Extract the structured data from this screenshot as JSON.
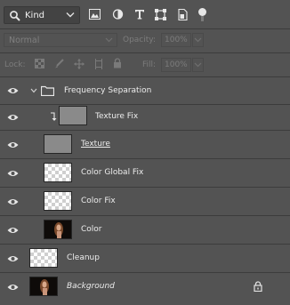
{
  "filter": {
    "kind_label": "Kind"
  },
  "blend": {
    "mode": "Normal"
  },
  "opacity": {
    "label": "Opacity:",
    "value": "100%"
  },
  "lock": {
    "label": "Lock:"
  },
  "fill": {
    "label": "Fill:",
    "value": "100%"
  },
  "colors": {
    "panel_bg": "#535353",
    "row_sep": "#3c3c3c",
    "text": "#ececec",
    "dim_text": "#7c7c7c"
  },
  "layers": [
    {
      "name": "Frequency Separation",
      "type": "group",
      "icon": "folder-icon",
      "expanded": true
    },
    {
      "name": "Texture Fix",
      "type": "clipped",
      "thumbnail": "gray"
    },
    {
      "name": "Texture",
      "type": "layer",
      "thumbnail": "gray"
    },
    {
      "name": "Color Global Fix",
      "type": "layer",
      "thumbnail": "transparent"
    },
    {
      "name": "Color Fix",
      "type": "layer",
      "thumbnail": "transparent"
    },
    {
      "name": "Color",
      "type": "layer",
      "thumbnail": "photo"
    },
    {
      "name": "Cleanup",
      "type": "layer",
      "thumbnail": "transparent"
    },
    {
      "name": "Background",
      "type": "background",
      "thumbnail": "photo",
      "locked": true
    }
  ]
}
